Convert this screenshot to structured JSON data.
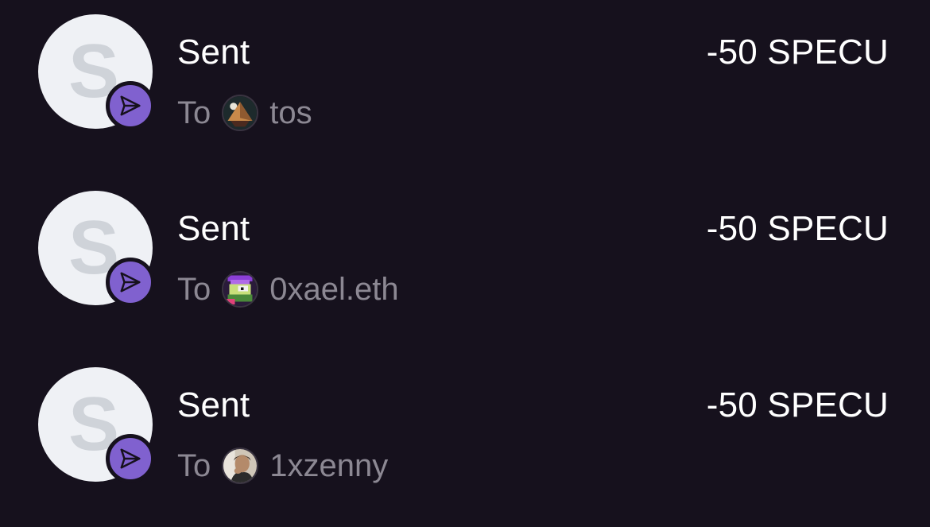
{
  "transactions": [
    {
      "token_letter": "S",
      "title": "Sent",
      "to_label": "To",
      "recipient": "tos",
      "recipient_avatar_icon": "pyramid-avatar-icon",
      "amount": "-50 SPECU"
    },
    {
      "token_letter": "S",
      "title": "Sent",
      "to_label": "To",
      "recipient": "0xael.eth",
      "recipient_avatar_icon": "pixel-art-avatar-icon",
      "amount": "-50 SPECU"
    },
    {
      "token_letter": "S",
      "title": "Sent",
      "to_label": "To",
      "recipient": "1xzenny",
      "recipient_avatar_icon": "photo-avatar-icon",
      "amount": "-50 SPECU"
    }
  ],
  "colors": {
    "background": "#16111d",
    "badge": "#8061cf",
    "primary_text": "#ffffff",
    "secondary_text": "#8c8893",
    "token_avatar_bg": "#eff1f5",
    "token_letter": "#cfd3d9"
  },
  "icons": {
    "badge": "send-arrow-icon"
  }
}
